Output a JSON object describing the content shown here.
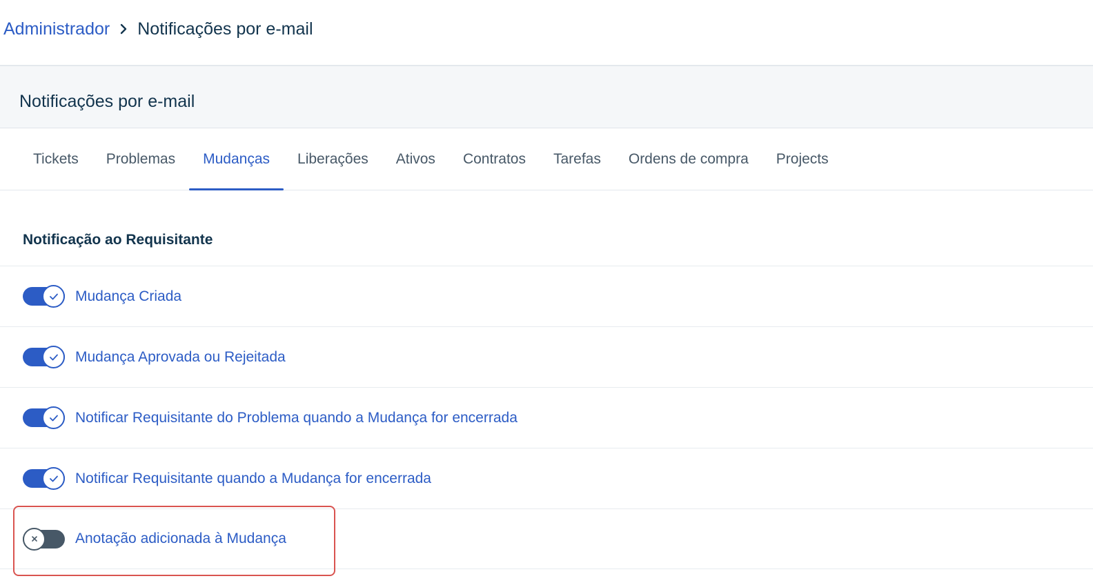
{
  "breadcrumb": {
    "parent": "Administrador",
    "current": "Notificações por e-mail"
  },
  "panel": {
    "title": "Notificações por e-mail"
  },
  "tabs": [
    {
      "label": "Tickets",
      "active": false
    },
    {
      "label": "Problemas",
      "active": false
    },
    {
      "label": "Mudanças",
      "active": true
    },
    {
      "label": "Liberações",
      "active": false
    },
    {
      "label": "Ativos",
      "active": false
    },
    {
      "label": "Contratos",
      "active": false
    },
    {
      "label": "Tarefas",
      "active": false
    },
    {
      "label": "Ordens de compra",
      "active": false
    },
    {
      "label": "Projects",
      "active": false
    }
  ],
  "section": {
    "title": "Notificação ao Requisitante",
    "items": [
      {
        "label": "Mudança Criada",
        "enabled": true
      },
      {
        "label": "Mudança Aprovada ou Rejeitada",
        "enabled": true
      },
      {
        "label": "Notificar Requisitante do Problema quando a Mudança for encerrada",
        "enabled": true
      },
      {
        "label": "Notificar Requisitante quando a Mudança for encerrada",
        "enabled": true
      },
      {
        "label": "Anotação adicionada à Mudança",
        "enabled": false
      }
    ]
  },
  "colors": {
    "accent": "#2c5cc5",
    "toggle_off": "#475867",
    "highlight": "#d9534f"
  },
  "icons": {
    "breadcrumb_separator": "chevron-right-icon",
    "toggle_on": "check-icon",
    "toggle_off": "close-icon"
  }
}
